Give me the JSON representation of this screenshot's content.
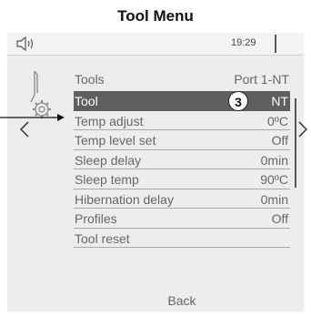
{
  "caption": "Tool Menu",
  "status_bar": {
    "sound_icon": "speaker-icon",
    "time": "19:29"
  },
  "header": {
    "icon": "tool-settings-icon",
    "label": "Tools",
    "value": "Port 1-NT"
  },
  "menu": [
    {
      "label": "Tool",
      "value": "NT",
      "selected": true,
      "callout": "3"
    },
    {
      "label": "Temp adjust",
      "value": "0ºC"
    },
    {
      "label": "Temp level set",
      "value": "Off"
    },
    {
      "label": "Sleep delay",
      "value": "0min"
    },
    {
      "label": "Sleep temp",
      "value": "90ºC"
    },
    {
      "label": "Hibernation delay",
      "value": "0min"
    },
    {
      "label": "Profiles",
      "value": "Off"
    },
    {
      "label": "Tool reset",
      "value": ""
    }
  ],
  "back_label": "Back",
  "nav": {
    "prev_icon": "chevron-left-icon",
    "next_icon": "chevron-right-icon"
  },
  "colors": {
    "selected_row": "#5f5f62",
    "screen_bg": "#ededee"
  }
}
